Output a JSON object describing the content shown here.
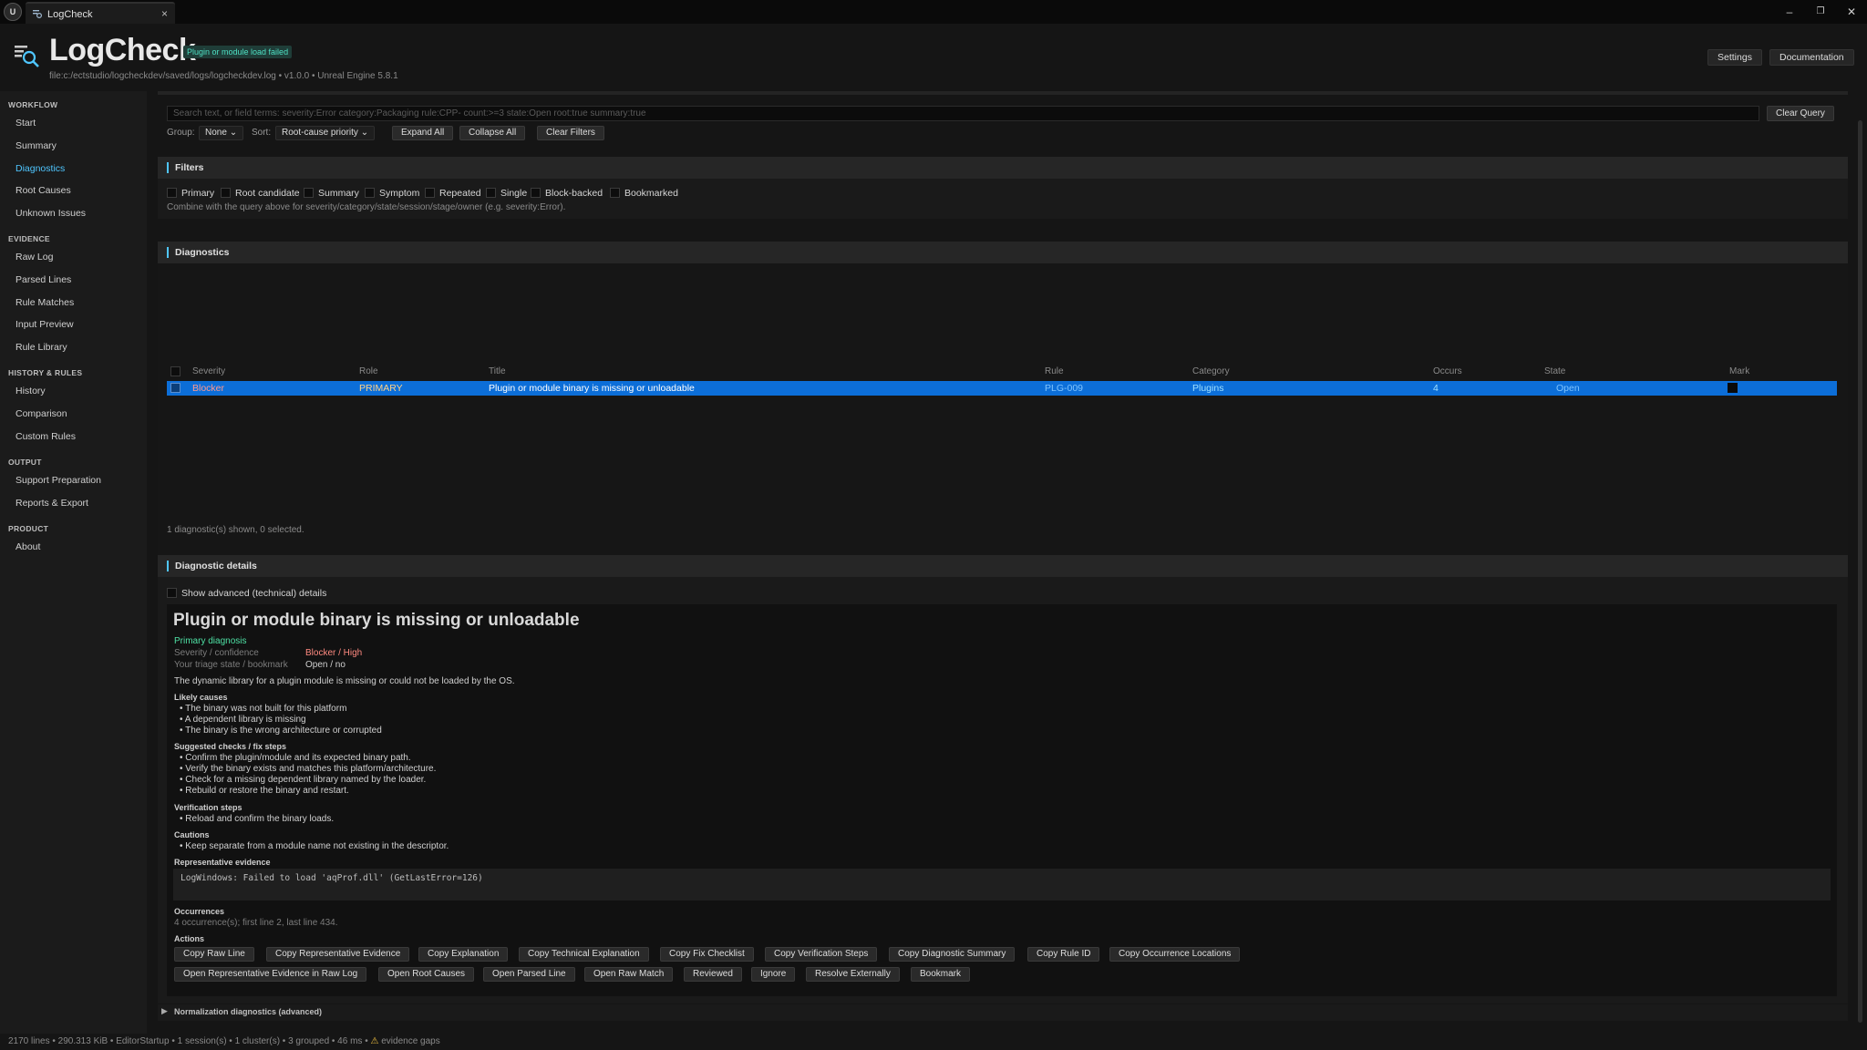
{
  "window": {
    "tab_label": "LogCheck",
    "tab_close": "×",
    "ue_logo": "U",
    "controls": [
      "–",
      "❐",
      "✕"
    ]
  },
  "header": {
    "title": "LogCheck",
    "status_badge": "Plugin or module load failed",
    "file_path": "file:c:/ectstudio/logcheckdev/saved/logs/logcheckdev.log",
    "version": "v1.0.0",
    "engine": "Unreal Engine 5.8.1",
    "settings_label": "Settings",
    "docs_label": "Documentation"
  },
  "sidebar": {
    "workflow": {
      "label": "WORKFLOW",
      "items": [
        "Start",
        "Summary",
        "Diagnostics",
        "Root Causes",
        "Unknown Issues"
      ]
    },
    "evidence": {
      "label": "EVIDENCE",
      "items": [
        "Raw Log",
        "Parsed Lines",
        "Rule Matches",
        "Input Preview",
        "Rule Library"
      ]
    },
    "history": {
      "label": "HISTORY & RULES",
      "items": [
        "History",
        "Comparison",
        "Custom Rules"
      ]
    },
    "output": {
      "label": "OUTPUT",
      "items": [
        "Support Preparation",
        "Reports & Export"
      ]
    },
    "product": {
      "label": "PRODUCT",
      "items": [
        "About"
      ]
    }
  },
  "toolbar": {
    "search_placeholder": "Search text, or field terms: severity:Error category:Packaging rule:CPP- count:>=3 state:Open root:true summary:true",
    "clear_query": "Clear Query",
    "group_label": "Group:",
    "group_value": "None",
    "sort_label": "Sort:",
    "sort_value": "Root-cause priority",
    "expand_all": "Expand All",
    "collapse_all": "Collapse All",
    "clear_filters": "Clear Filters"
  },
  "filters": {
    "title": "Filters",
    "options": [
      "Primary",
      "Root candidate",
      "Summary",
      "Symptom",
      "Repeated",
      "Single",
      "Block-backed",
      "Bookmarked"
    ],
    "hint": "Combine with the query above for severity/category/state/session/stage/owner (e.g. severity:Error)."
  },
  "diagnostics": {
    "title": "Diagnostics",
    "columns": [
      "Severity",
      "Role",
      "Title",
      "Rule",
      "Category",
      "Occurs",
      "State",
      "Mark"
    ],
    "rows": [
      {
        "severity": "Blocker",
        "role": "PRIMARY",
        "title": "Plugin or module binary is missing or unloadable",
        "rule": "PLG-009",
        "category": "Plugins",
        "occurs": "4",
        "state": "Open"
      }
    ],
    "footer": "1 diagnostic(s) shown, 0 selected."
  },
  "details": {
    "title": "Diagnostic details",
    "advanced_toggle": "Show advanced (technical) details",
    "heading": "Plugin or module binary is missing or unloadable",
    "primary_label": "Primary diagnosis",
    "severity_key": "Severity / confidence",
    "severity_value": "Blocker / High",
    "triage_key": "Your triage state / bookmark",
    "triage_value": "Open / no",
    "description": "The dynamic library for a plugin module is missing or could not be loaded by the OS.",
    "likely_causes_title": "Likely causes",
    "likely_causes": [
      "• The binary was not built for this platform",
      "• A dependent library is missing",
      "• The binary is the wrong architecture or corrupted"
    ],
    "checks_title": "Suggested checks / fix steps",
    "checks": [
      "• Confirm the plugin/module and its expected binary path.",
      "• Verify the binary exists and matches this platform/architecture.",
      "• Check for a missing dependent library named by the loader.",
      "• Rebuild or restore the binary and restart."
    ],
    "verification_title": "Verification steps",
    "verification": [
      "• Reload and confirm the binary loads."
    ],
    "cautions_title": "Cautions",
    "cautions": [
      "• Keep separate from a module name not existing in the descriptor."
    ],
    "evidence_title": "Representative evidence",
    "evidence": "LogWindows: Failed to load 'aqProf.dll' (GetLastError=126)",
    "occurrences_title": "Occurrences",
    "occurrences": "4 occurrence(s); first line 2, last line 434.",
    "actions_title": "Actions",
    "actions_row1": [
      "Copy Raw Line",
      "Copy Representative Evidence",
      "Copy Explanation",
      "Copy Technical Explanation",
      "Copy Fix Checklist",
      "Copy Verification Steps",
      "Copy Diagnostic Summary",
      "Copy Rule ID",
      "Copy Occurrence Locations"
    ],
    "actions_row2": [
      "Open Representative Evidence in Raw Log",
      "Open Root Causes",
      "Open Parsed Line",
      "Open Raw Match",
      "Reviewed",
      "Ignore",
      "Resolve Externally",
      "Bookmark"
    ]
  },
  "normalization": {
    "label": "Normalization diagnostics (advanced)"
  },
  "statusbar": {
    "text": "2170 lines  •  290.313 KiB  •  EditorStartup  •  1 session(s)  •  1 cluster(s)  •  3 grouped  •  46 ms  •",
    "warning_icon": "⚠",
    "warning": "evidence gaps"
  },
  "colors": {
    "accent": "#4fc6ff",
    "selection": "#0c6ed8",
    "badge_text": "#4ee0c4",
    "blocker": "#ff8a80",
    "primary_diag": "#4ee0a4"
  }
}
